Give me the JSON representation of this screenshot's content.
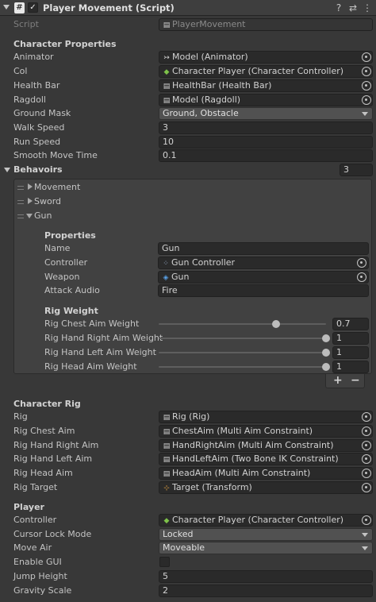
{
  "header": {
    "title": "Player Movement (Script)",
    "script_glyph": "#",
    "enabled_glyph": "✓",
    "help_glyph": "?",
    "settings_glyph": "⇄",
    "menu_glyph": "⋮"
  },
  "script": {
    "label": "Script",
    "value": "PlayerMovement"
  },
  "character_properties": {
    "heading": "Character Properties",
    "animator": {
      "label": "Animator",
      "value": "Model (Animator)",
      "icon": "↣"
    },
    "col": {
      "label": "Col",
      "value": "Character Player (Character Controller)",
      "icon": "◆"
    },
    "health_bar": {
      "label": "Health Bar",
      "value": "HealthBar (Health Bar)",
      "icon": "▤"
    },
    "ragdoll": {
      "label": "Ragdoll",
      "value": "Model (Ragdoll)",
      "icon": "▤"
    },
    "ground_mask": {
      "label": "Ground Mask",
      "value": "Ground, Obstacle"
    },
    "walk_speed": {
      "label": "Walk Speed",
      "value": "3"
    },
    "run_speed": {
      "label": "Run Speed",
      "value": "10"
    },
    "smooth_move_time": {
      "label": "Smooth Move Time",
      "value": "0.1"
    }
  },
  "behaviors": {
    "label": "Behavoirs",
    "count": "3",
    "items": [
      {
        "label": "Movement"
      },
      {
        "label": "Sword"
      },
      {
        "label": "Gun"
      }
    ],
    "gun": {
      "properties_heading": "Properties",
      "name": {
        "label": "Name",
        "value": "Gun"
      },
      "controller": {
        "label": "Controller",
        "value": "Gun Controller",
        "icon": "⁘"
      },
      "weapon": {
        "label": "Weapon",
        "value": "Gun",
        "icon": "◈"
      },
      "attack_audio": {
        "label": "Attack Audio",
        "value": "Fire"
      },
      "rig_weight_heading": "Rig Weight",
      "sliders": [
        {
          "label": "Rig Chest Aim Weight",
          "value": "0.7",
          "fraction": 0.7
        },
        {
          "label": "Rig Hand Right Aim Weight",
          "value": "1",
          "fraction": 1
        },
        {
          "label": "Rig Hand Left Aim Weight",
          "value": "1",
          "fraction": 1
        },
        {
          "label": "Rig Head Aim Weight",
          "value": "1",
          "fraction": 1
        }
      ]
    },
    "add_glyph": "+",
    "remove_glyph": "−"
  },
  "character_rig": {
    "heading": "Character Rig",
    "rig": {
      "label": "Rig",
      "value": "Rig (Rig)",
      "icon": "▤"
    },
    "chest_aim": {
      "label": "Rig Chest Aim",
      "value": "ChestAim (Multi Aim Constraint)",
      "icon": "▤"
    },
    "hand_right_aim": {
      "label": "Rig Hand Right Aim",
      "value": "HandRightAim (Multi Aim Constraint)",
      "icon": "▤"
    },
    "hand_left_aim": {
      "label": "Rig Hand Left Aim",
      "value": "HandLeftAim  (Two Bone IK Constraint)",
      "icon": "▤"
    },
    "head_aim": {
      "label": "Rig Head Aim",
      "value": "HeadAim (Multi Aim Constraint)",
      "icon": "▤"
    },
    "target": {
      "label": "Rig Target",
      "value": "Target (Transform)",
      "icon": "⊹"
    }
  },
  "player": {
    "heading": "Player",
    "controller": {
      "label": "Controller",
      "value": "Character Player (Character Controller)",
      "icon": "◆"
    },
    "cursor_lock_mode": {
      "label": "Cursor Lock Mode",
      "value": "Locked"
    },
    "move_air": {
      "label": "Move Air",
      "value": "Moveable"
    },
    "enable_gui": {
      "label": "Enable GUI",
      "checked": false
    },
    "jump_height": {
      "label": "Jump Height",
      "value": "5"
    },
    "gravity_scale": {
      "label": "Gravity Scale",
      "value": "2"
    }
  }
}
